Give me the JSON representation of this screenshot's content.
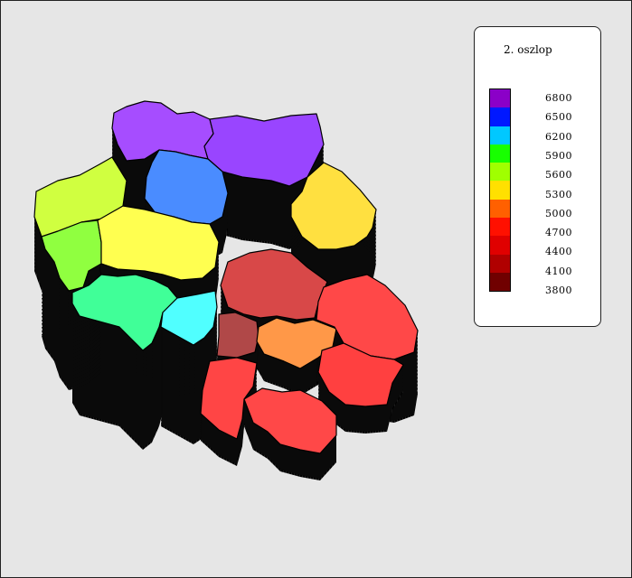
{
  "legend": {
    "title": "2. oszlop",
    "entries": [
      {
        "label": "6800",
        "color": "#8b00c8"
      },
      {
        "label": "6500",
        "color": "#0018ff"
      },
      {
        "label": "6200",
        "color": "#00c8ff"
      },
      {
        "label": "5900",
        "color": "#18ff00"
      },
      {
        "label": "5600",
        "color": "#a0ff00"
      },
      {
        "label": "5300",
        "color": "#ffe000"
      },
      {
        "label": "5000",
        "color": "#ff6000"
      },
      {
        "label": "4700",
        "color": "#ff1000"
      },
      {
        "label": "4400",
        "color": "#e00000"
      },
      {
        "label": "4100",
        "color": "#b00000"
      },
      {
        "label": "3800",
        "color": "#700000"
      }
    ]
  },
  "regions": [
    {
      "id": "north-west",
      "color": "#a64dff"
    },
    {
      "id": "north-east",
      "color": "#9945ff"
    },
    {
      "id": "north-center",
      "color": "#4a8cff"
    },
    {
      "id": "west-top",
      "color": "#d0ff40"
    },
    {
      "id": "east-top",
      "color": "#ffe040"
    },
    {
      "id": "west-mid",
      "color": "#90ff40"
    },
    {
      "id": "center-west",
      "color": "#ffff50"
    },
    {
      "id": "center-east",
      "color": "#d84848"
    },
    {
      "id": "south-west",
      "color": "#40ff98"
    },
    {
      "id": "south-center",
      "color": "#50ffff"
    },
    {
      "id": "center-small",
      "color": "#b04848"
    },
    {
      "id": "center-orange",
      "color": "#ff9848"
    },
    {
      "id": "east-mid",
      "color": "#ff4848"
    },
    {
      "id": "south-east-a",
      "color": "#ff4545"
    },
    {
      "id": "south-east-b",
      "color": "#ff4848"
    },
    {
      "id": "south-east-c",
      "color": "#ff4040"
    }
  ]
}
